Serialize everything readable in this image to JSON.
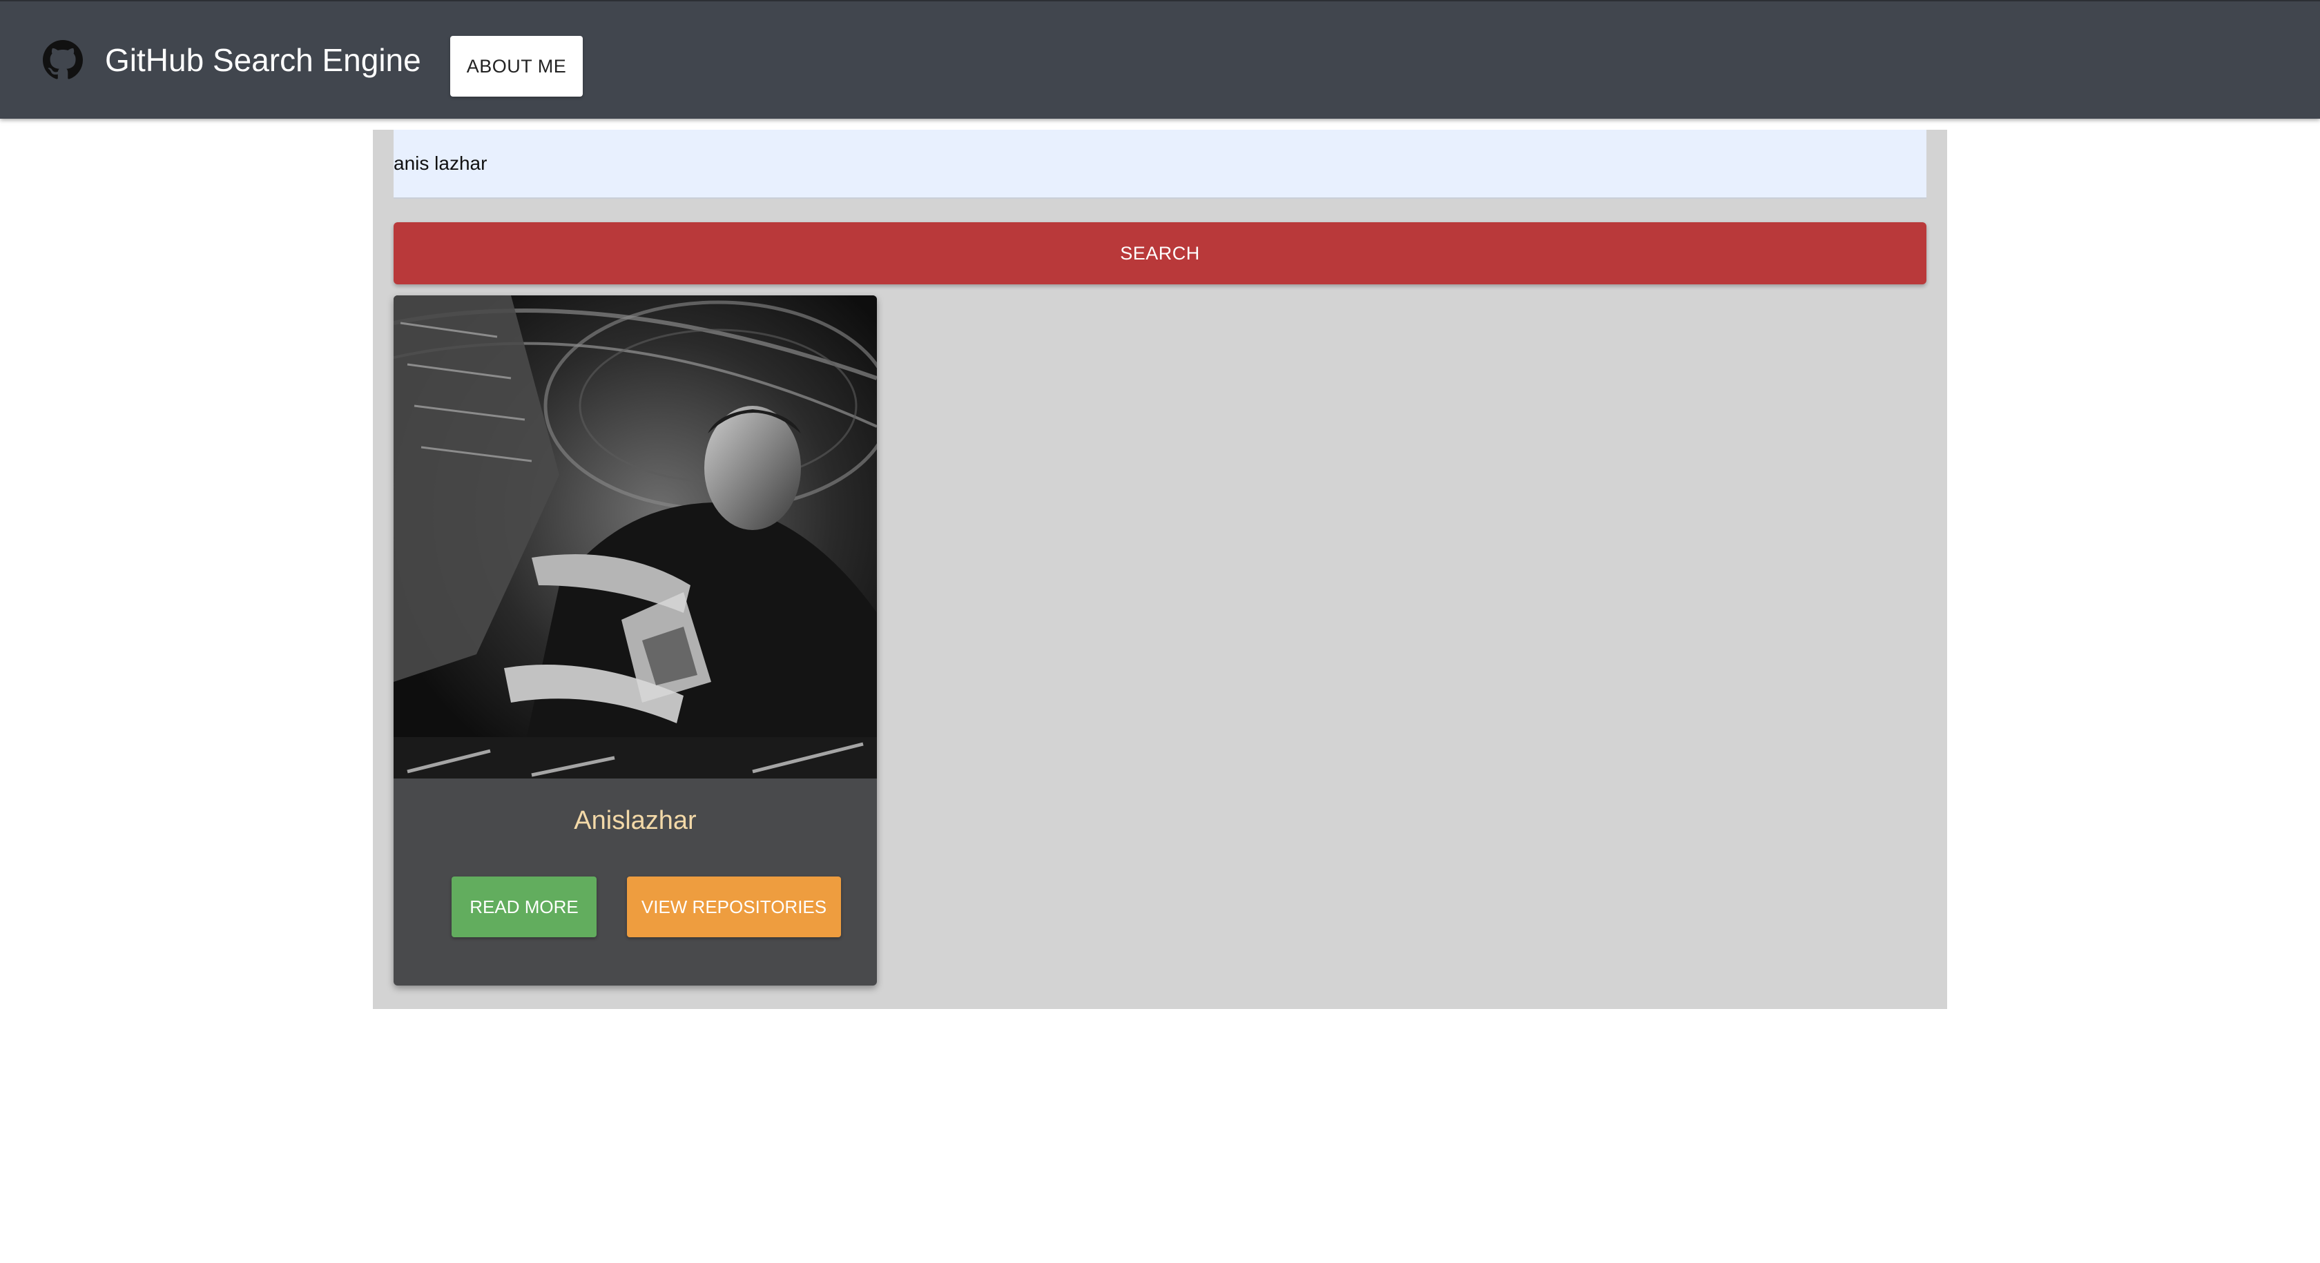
{
  "header": {
    "title": "GitHub Search Engine",
    "about_label": "ABOUT ME",
    "logo_icon": "github-icon"
  },
  "search": {
    "value": "anis lazhar",
    "placeholder": "",
    "button_label": "SEARCH"
  },
  "results": [
    {
      "name": "Anislazhar",
      "read_more_label": "READ MORE",
      "repos_label": "VIEW REPOSITORIES"
    }
  ],
  "colors": {
    "topbar": "#41464e",
    "search_button": "#b9393a",
    "read_more": "#62ad5e",
    "view_repos": "#ee9d3f",
    "card": "#494a4c",
    "card_name": "#f3d9a8",
    "panel": "#d3d3d3"
  }
}
